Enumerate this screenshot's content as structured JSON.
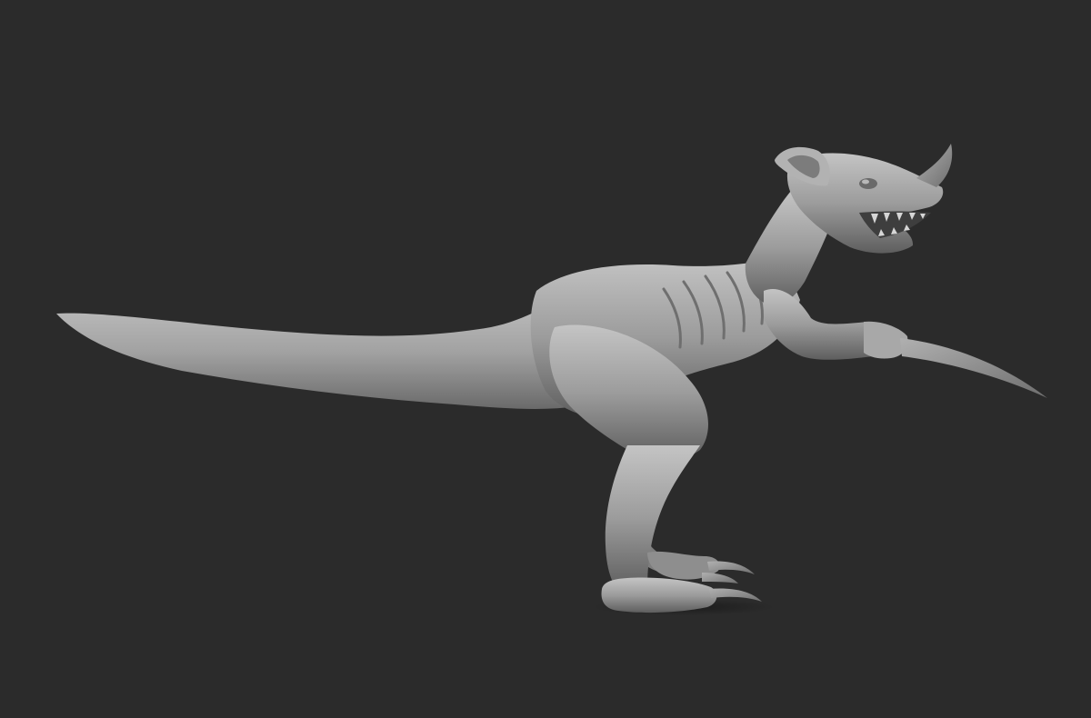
{
  "viewport": {
    "background_color": "#2b2b2b",
    "model_color": "#9c9c9c",
    "model_highlight": "#c4c4c4",
    "model_shadow": "#5e5e5e",
    "claw_color": "#8a8a8a",
    "ground_shadow_color": "#1e1e1e"
  }
}
